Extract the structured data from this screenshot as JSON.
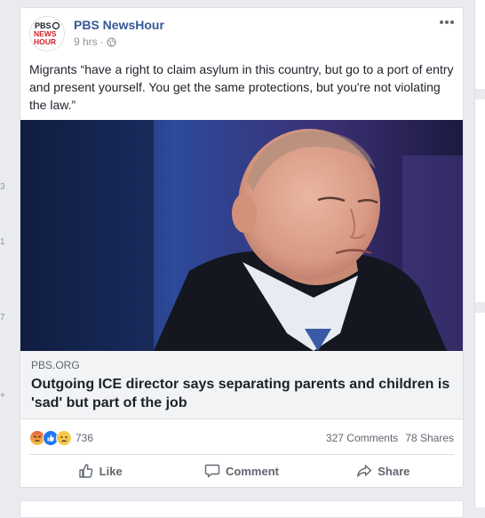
{
  "left_strip": {
    "fragments": [
      "3",
      "1",
      "7",
      "+"
    ]
  },
  "post": {
    "page_name": "PBS NewsHour",
    "avatar_logo_lines": [
      "PBS",
      "NEWS",
      "HOUR"
    ],
    "timestamp": "9 hrs",
    "separator": "·",
    "privacy_icon": "globe-icon",
    "more_icon": "more-horizontal-icon",
    "text": "Migrants “have a right to claim asylum in this country, but go to a port of entry and present yourself. You get the same protections, but you're not violating the law.”",
    "link": {
      "domain": "PBS.ORG",
      "title": "Outgoing ICE director says separating parents and children is 'sad' but part of the job"
    },
    "reactions": {
      "icons": [
        "angry-reaction-icon",
        "like-reaction-icon",
        "sad-reaction-icon"
      ],
      "count": "736"
    },
    "comments": "327 Comments",
    "shares": "78 Shares",
    "actions": [
      {
        "label": "Like",
        "icon": "thumbs-up-icon"
      },
      {
        "label": "Comment",
        "icon": "comment-bubble-icon"
      },
      {
        "label": "Share",
        "icon": "share-arrow-icon"
      }
    ]
  },
  "colors": {
    "page_bg": "#e9ebee",
    "link_blue": "#365899",
    "secondary_text": "#606770",
    "meta_text": "#90949c",
    "pbs_red": "#d51e23"
  }
}
